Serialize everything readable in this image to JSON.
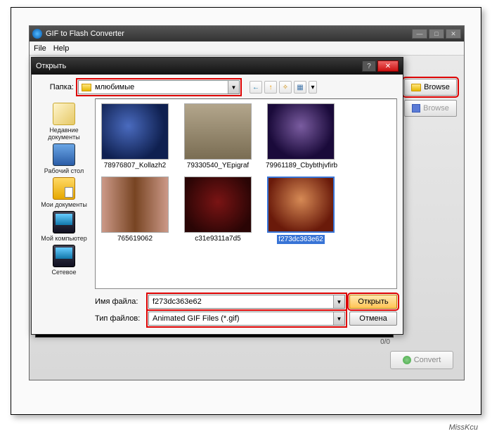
{
  "app": {
    "title": "GIF to Flash Converter",
    "menu": {
      "file": "File",
      "help": "Help"
    },
    "browse1": "Browse",
    "browse2": "Browse",
    "convert": "Convert",
    "counter": "0/0"
  },
  "dialog": {
    "title": "Открыть",
    "look_in_label": "Папка:",
    "folder_name": "млюбимые",
    "sidebar": {
      "recent": "Недавние документы",
      "desktop": "Рабочий стол",
      "docs": "Мои документы",
      "computer": "Мой компьютер",
      "network": "Сетевое"
    },
    "files": [
      {
        "name": "78976807_Kollazh2"
      },
      {
        "name": "79330540_YEpigraf"
      },
      {
        "name": "79961189_Cbybthjvfirb"
      },
      {
        "name": "765619062"
      },
      {
        "name": "c31e9311a7d5"
      },
      {
        "name": "f273dc363e62",
        "selected": true
      }
    ],
    "filename_label": "Имя файла:",
    "filename_value": "f273dc363e62",
    "filetype_label": "Тип файлов:",
    "filetype_value": "Animated GIF Files (*.gif)",
    "open_btn": "Открыть",
    "cancel_btn": "Отмена"
  },
  "watermark": "MissKcu"
}
